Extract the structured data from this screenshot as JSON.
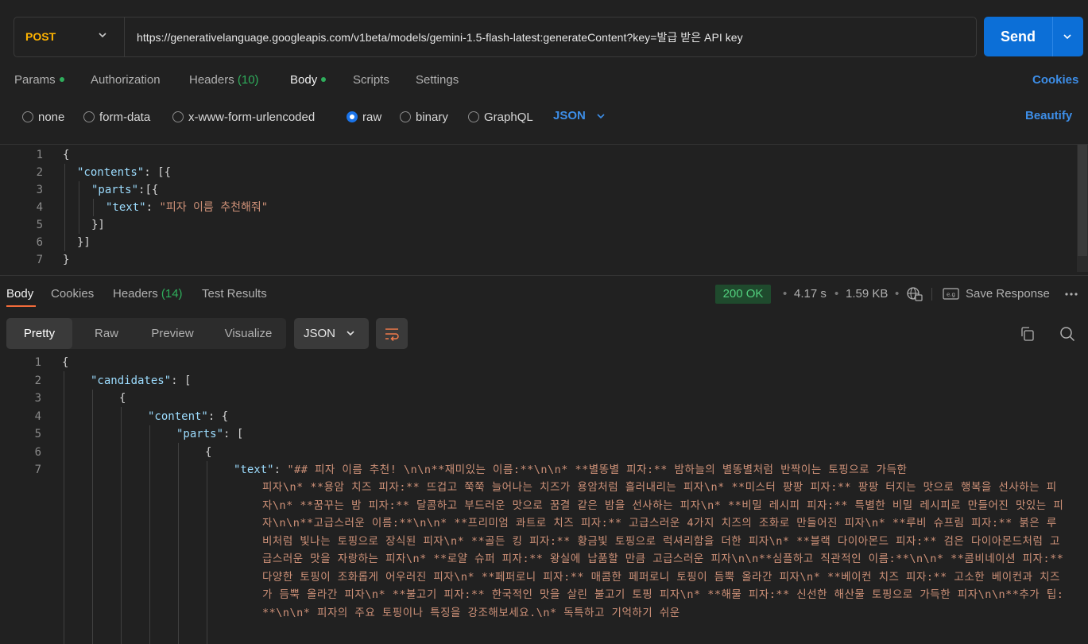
{
  "request": {
    "method": "POST",
    "url": "https://generativelanguage.googleapis.com/v1beta/models/gemini-1.5-flash-latest:generateContent?key=발급 받은 API key",
    "send_label": "Send"
  },
  "request_tabs": {
    "params": "Params",
    "authorization": "Authorization",
    "headers": "Headers",
    "headers_count": "(10)",
    "body": "Body",
    "scripts": "Scripts",
    "settings": "Settings",
    "cookies": "Cookies"
  },
  "body_types": {
    "none": "none",
    "form_data": "form-data",
    "urlencoded": "x-www-form-urlencoded",
    "raw": "raw",
    "binary": "binary",
    "graphql": "GraphQL",
    "selected": "raw",
    "language": "JSON",
    "beautify": "Beautify"
  },
  "request_body": {
    "line_numbers": [
      "1",
      "2",
      "3",
      "4",
      "5",
      "6",
      "7"
    ],
    "l1": "{",
    "l2_key": "\"contents\"",
    "l2_rest": ": [{",
    "l3_key": "\"parts\"",
    "l3_rest": ":[{",
    "l4_key": "\"text\"",
    "l4_colon": ": ",
    "l4_val": "\"피자 이름 추천해줘\"",
    "l5": "}]",
    "l6": "}]",
    "l7": "}"
  },
  "response_tabs": {
    "body": "Body",
    "cookies": "Cookies",
    "headers": "Headers",
    "headers_count": "(14)",
    "test_results": "Test Results"
  },
  "response_meta": {
    "status": "200 OK",
    "time": "4.17 s",
    "size": "1.59 KB",
    "save_response": "Save Response"
  },
  "response_view": {
    "pretty": "Pretty",
    "raw": "Raw",
    "preview": "Preview",
    "visualize": "Visualize",
    "format": "JSON"
  },
  "response_body": {
    "line_numbers": [
      "1",
      "2",
      "3",
      "4",
      "5",
      "6",
      "7"
    ],
    "l1": "{",
    "l2_key": "\"candidates\"",
    "l2_rest": ": [",
    "l3": "{",
    "l4_key": "\"content\"",
    "l4_rest": ": {",
    "l5_key": "\"parts\"",
    "l5_rest": ": [",
    "l6": "{",
    "l7_key": "\"text\"",
    "l7_colon": ": ",
    "l7_first": "\"## 피자 이름 추천! \\n\\n**재미있는 이름:**\\n\\n* **별똥별 피자:** 밤하늘의 별똥별처럼 반짝이는 토핑으로 가득한",
    "l7_wrapped": "피자\\n* **용암 치즈 피자:** 뜨겁고 쭉쭉 늘어나는 치즈가 용암처럼 흘러내리는 피자\\n* **미스터 팡팡 피자:** 팡팡 터지는 맛으로 행복을 선사하는 피자\\n* **꿈꾸는 밤 피자:** 달콤하고 부드러운 맛으로 꿈결 같은 밤을 선사하는 피자\\n* **비밀 레시피 피자:** 특별한 비밀 레시피로 만들어진 맛있는 피자\\n\\n**고급스러운 이름:**\\n\\n* **프리미엄 콰트로 치즈 피자:** 고급스러운 4가지 치즈의 조화로 만들어진 피자\\n* **루비 슈프림 피자:** 붉은 루비처럼 빛나는 토핑으로 장식된 피자\\n* **골든 킹 피자:** 황금빛 토핑으로 럭셔리함을 더한 피자\\n* **블랙 다이아몬드 피자:** 검은 다이아몬드처럼 고급스러운 맛을 자랑하는 피자\\n* **로얄 슈퍼 피자:** 왕실에 납품할 만큼 고급스러운 피자\\n\\n**심플하고 직관적인 이름:**\\n\\n* **콤비네이션 피자:** 다양한 토핑이 조화롭게 어우러진 피자\\n* **페퍼로니 피자:** 매콤한 페퍼로니 토핑이 듬뿍 올라간 피자\\n* **베이컨 치즈 피자:** 고소한 베이컨과 치즈가 듬뿍 올라간 피자\\n* **불고기 피자:** 한국적인 맛을 살린 불고기 토핑 피자\\n* **해물 피자:** 신선한 해산물 토핑으로 가득한 피자\\n\\n**추가 팁:**\\n\\n* 피자의 주요 토핑이나 특징을 강조해보세요.\\n* 독특하고 기억하기 쉬운"
  },
  "colors": {
    "accent": "#0c6fd7",
    "method": "#ffb400",
    "status_ok": "#52d07e",
    "active_underline": "#f26b3a"
  }
}
